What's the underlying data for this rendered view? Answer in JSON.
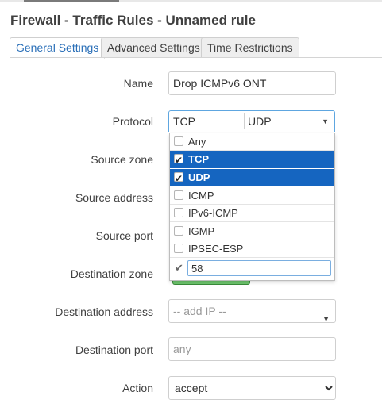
{
  "title": "Firewall - Traffic Rules - Unnamed rule",
  "tabs": [
    {
      "label": "General Settings"
    },
    {
      "label": "Advanced Settings"
    },
    {
      "label": "Time Restrictions"
    }
  ],
  "fields": {
    "name": {
      "label": "Name",
      "value": "Drop ICMPv6 ONT"
    },
    "protocol": {
      "label": "Protocol",
      "selected": [
        "TCP",
        "UDP"
      ]
    },
    "source_zone": {
      "label": "Source zone"
    },
    "source_address": {
      "label": "Source address"
    },
    "source_port": {
      "label": "Source port"
    },
    "destination_zone": {
      "label": "Destination zone"
    },
    "destination_address": {
      "label": "Destination address",
      "placeholder": "-- add IP --"
    },
    "destination_port": {
      "label": "Destination port",
      "placeholder": "any"
    },
    "action": {
      "label": "Action",
      "value": "accept"
    }
  },
  "protocol_options": [
    {
      "label": "Any",
      "checked": false
    },
    {
      "label": "TCP",
      "checked": true
    },
    {
      "label": "UDP",
      "checked": true
    },
    {
      "label": "ICMP",
      "checked": false
    },
    {
      "label": "IPv6-ICMP",
      "checked": false
    },
    {
      "label": "IGMP",
      "checked": false
    },
    {
      "label": "IPSEC-ESP",
      "checked": false
    }
  ],
  "custom_protocol_value": "58",
  "colors": {
    "accent": "#2a6fb8",
    "selected_row": "#1565c0",
    "zone_green": "#6cc46c"
  },
  "icons": {
    "caret": "chevron-down-icon",
    "check": "checkmark-icon"
  }
}
